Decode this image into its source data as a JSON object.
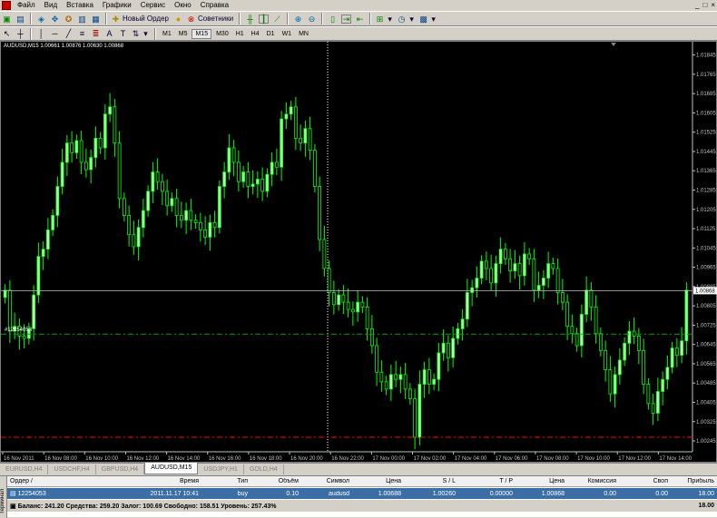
{
  "menu": [
    "Файл",
    "Вид",
    "Вставка",
    "Графики",
    "Сервис",
    "Окно",
    "Справка"
  ],
  "window_controls": [
    "_",
    "□",
    "×"
  ],
  "toolbar1": {
    "new_order_label": "Новый Ордер",
    "advisors_label": "Советники"
  },
  "toolbar2": {
    "timeframes": [
      "M1",
      "M5",
      "M15",
      "M30",
      "H1",
      "H4",
      "D1",
      "W1",
      "MN"
    ],
    "active_timeframe": "M15"
  },
  "chart": {
    "title": "AUDUSD,M15  1.00661 1.00876 1.00630 1.00868",
    "order_label": "#12254053",
    "price_labels": [
      "1.01845",
      "1.01765",
      "1.01685",
      "1.01605",
      "1.01525",
      "1.01445",
      "1.01365",
      "1.01285",
      "1.01205",
      "1.01125",
      "1.01045",
      "1.00965",
      "1.00885",
      "1.00805",
      "1.00725",
      "1.00645",
      "1.00565",
      "1.00485",
      "1.00405",
      "1.00325",
      "1.00245"
    ],
    "current_price": "1.00868",
    "time_labels": [
      "16 Nov 2011",
      "16 Nov 08:00",
      "16 Nov 10:00",
      "16 Nov 12:00",
      "16 Nov 14:00",
      "16 Nov 16:00",
      "16 Nov 18:00",
      "16 Nov 20:00",
      "16 Nov 22:00",
      "17 Nov 00:00",
      "17 Nov 02:00",
      "17 Nov 04:00",
      "17 Nov 06:00",
      "17 Nov 08:00",
      "17 Nov 10:00",
      "17 Nov 12:00",
      "17 Nov 14:00"
    ],
    "colors": {
      "bull": "#aaffaa",
      "bear": "#00ff00",
      "grid": "#000000",
      "bid": "#c0c0c0",
      "order": "#00aa00",
      "stoploss": "#ff0000"
    }
  },
  "chart_data": {
    "type": "candlestick",
    "symbol": "AUDUSD",
    "timeframe": "M15",
    "ylim": [
      1.002,
      1.019
    ],
    "entry_price": 1.00688,
    "stop_loss": 1.0026,
    "current_price": 1.00868,
    "closes": [
      1.0087,
      1.007,
      1.0072,
      1.0068,
      1.0067,
      1.0071,
      1.0085,
      1.0101,
      1.0104,
      1.0112,
      1.0118,
      1.013,
      1.014,
      1.0148,
      1.0144,
      1.0149,
      1.014,
      1.0137,
      1.0142,
      1.015,
      1.0146,
      1.016,
      1.0163,
      1.0148,
      1.0125,
      1.0118,
      1.011,
      1.0105,
      1.0113,
      1.012,
      1.0128,
      1.0136,
      1.0132,
      1.0128,
      1.0122,
      1.0125,
      1.0118,
      1.0116,
      1.012,
      1.0116,
      1.0115,
      1.0112,
      1.0109,
      1.0115,
      1.0113,
      1.013,
      1.0136,
      1.0146,
      1.014,
      1.0132,
      1.0136,
      1.013,
      1.0131,
      1.0133,
      1.0128,
      1.0135,
      1.014,
      1.0138,
      1.0158,
      1.016,
      1.0163,
      1.015,
      1.0148,
      1.0154,
      1.0145,
      1.013,
      1.0108,
      1.0096,
      1.0086,
      1.0081,
      1.0085,
      1.0082,
      1.0079,
      1.0078,
      1.0082,
      1.008,
      1.0071,
      1.0064,
      1.0053,
      1.0049,
      1.0046,
      1.0052,
      1.005,
      1.0052,
      1.0046,
      1.0042,
      1.0026,
      1.0048,
      1.0054,
      1.0048,
      1.005,
      1.0061,
      1.0065,
      1.0059,
      1.0067,
      1.0071,
      1.0075,
      1.0086,
      1.0088,
      1.0092,
      1.0099,
      1.0096,
      1.009,
      1.0098,
      1.0104,
      1.01,
      1.0095,
      1.0098,
      1.0093,
      1.0102,
      1.01,
      1.0087,
      1.0089,
      1.0092,
      1.0098,
      1.0096,
      1.0086,
      1.0082,
      1.0072,
      1.0069,
      1.0064,
      1.0077,
      1.0087,
      1.008,
      1.0069,
      1.0062,
      1.0054,
      1.0044,
      1.0052,
      1.0058,
      1.0065,
      1.007,
      1.0068,
      1.0062,
      1.0048,
      1.004,
      1.0036,
      1.0045,
      1.005,
      1.0055,
      1.0063,
      1.006,
      1.0066,
      1.0087
    ],
    "series": [
      {
        "name": "AUDUSD,M15",
        "values": "closes"
      }
    ]
  },
  "tabs": [
    "EURUSD,H4",
    "USDCHF,H4",
    "GBPUSD,H4",
    "AUDUSD,M15",
    "USDJPY,H1",
    "GOLD,H4"
  ],
  "active_tab": "AUDUSD,M15",
  "terminal": {
    "side_label": "Терминал",
    "headers": [
      "Ордер  /",
      "Время",
      "Тип",
      "Объём",
      "Символ",
      "Цена",
      "S / L",
      "T / P",
      "Цена",
      "Комиссия",
      "Своп",
      "Прибыль"
    ],
    "row": [
      "12254053",
      "2011.11.17 10:41",
      "buy",
      "0.10",
      "audusd",
      "1.00688",
      "1.00260",
      "0.00000",
      "1.00868",
      "0.00",
      "0.00",
      "18.00"
    ],
    "balance_line": "Баланс: 241.20  Средства: 259.20  Залог: 100.69  Свободно: 158.51  Уровень: 257.43%",
    "balance_profit": "18.00"
  }
}
